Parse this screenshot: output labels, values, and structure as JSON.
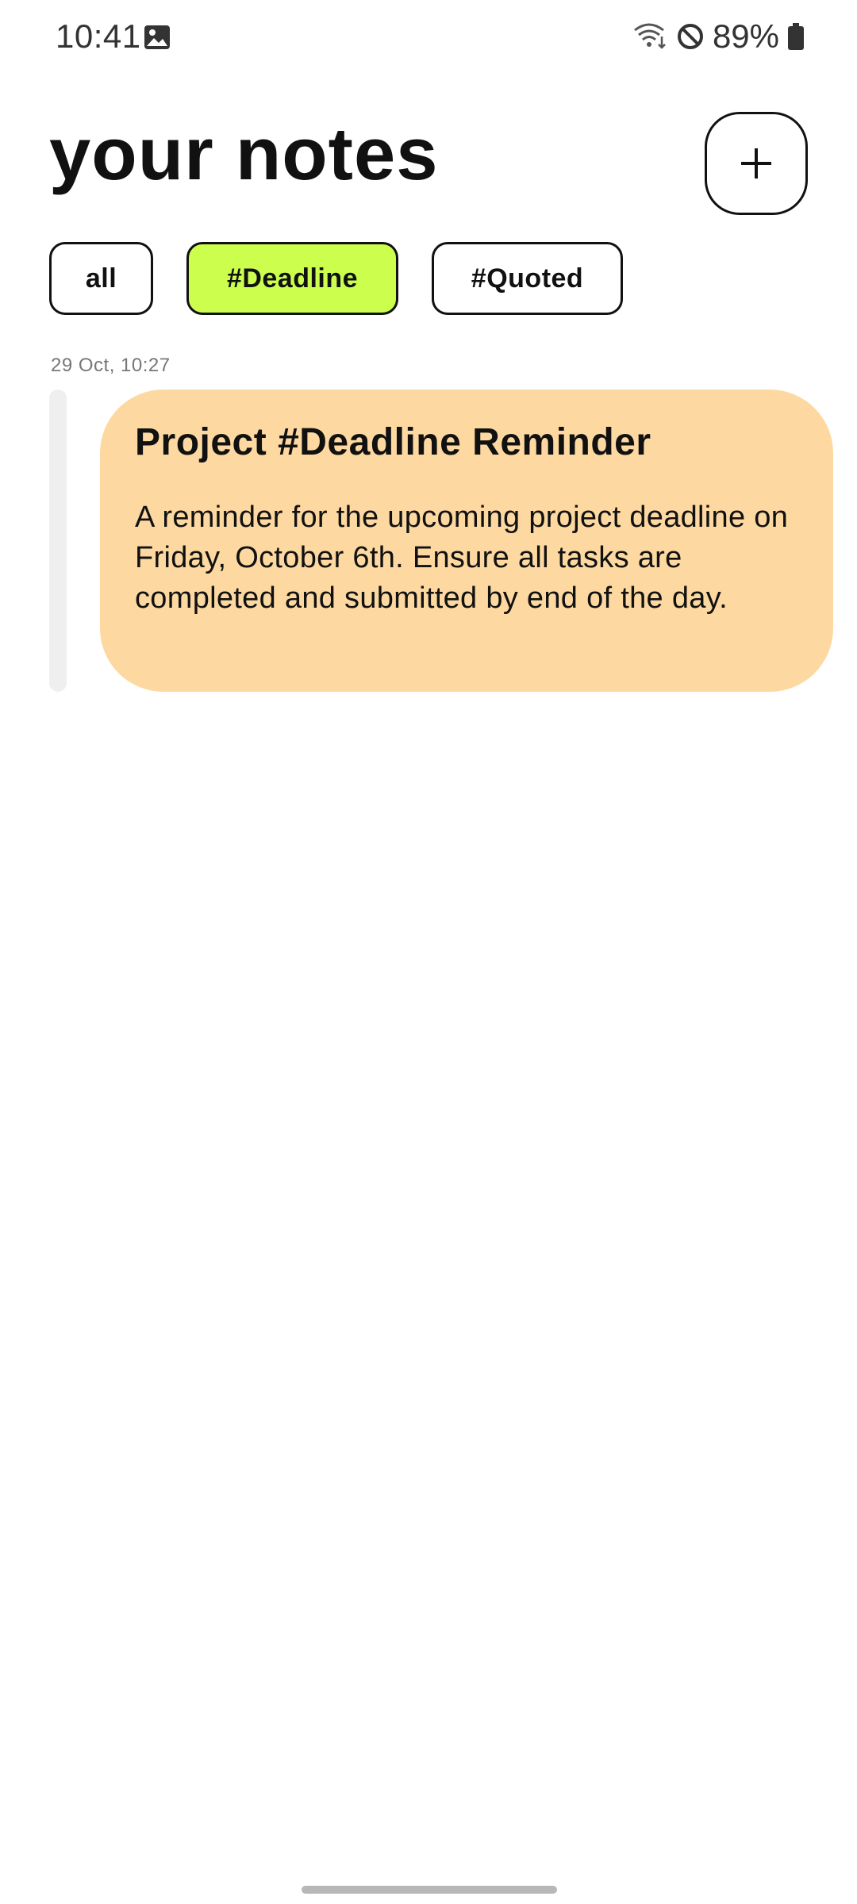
{
  "status_bar": {
    "time": "10:41",
    "battery_percent": "89%",
    "icons": [
      "gallery-icon",
      "wifi-icon",
      "do-not-disturb-icon",
      "battery-icon"
    ]
  },
  "header": {
    "title": "your notes",
    "add_button_label": "+"
  },
  "tags": [
    {
      "label": "all",
      "active": false
    },
    {
      "label": "#Deadline",
      "active": true
    },
    {
      "label": "#Quoted",
      "active": false
    }
  ],
  "notes": [
    {
      "date": "29 Oct, 10:27",
      "title": "Project #Deadline Reminder",
      "body": "A reminder for the upcoming project deadline on Friday, October 6th. Ensure all tasks are completed and submitted by end of the day."
    }
  ],
  "colors": {
    "accent_tag": "#CCFF4D",
    "note_card": "#FDD9A1",
    "text": "#111111"
  }
}
